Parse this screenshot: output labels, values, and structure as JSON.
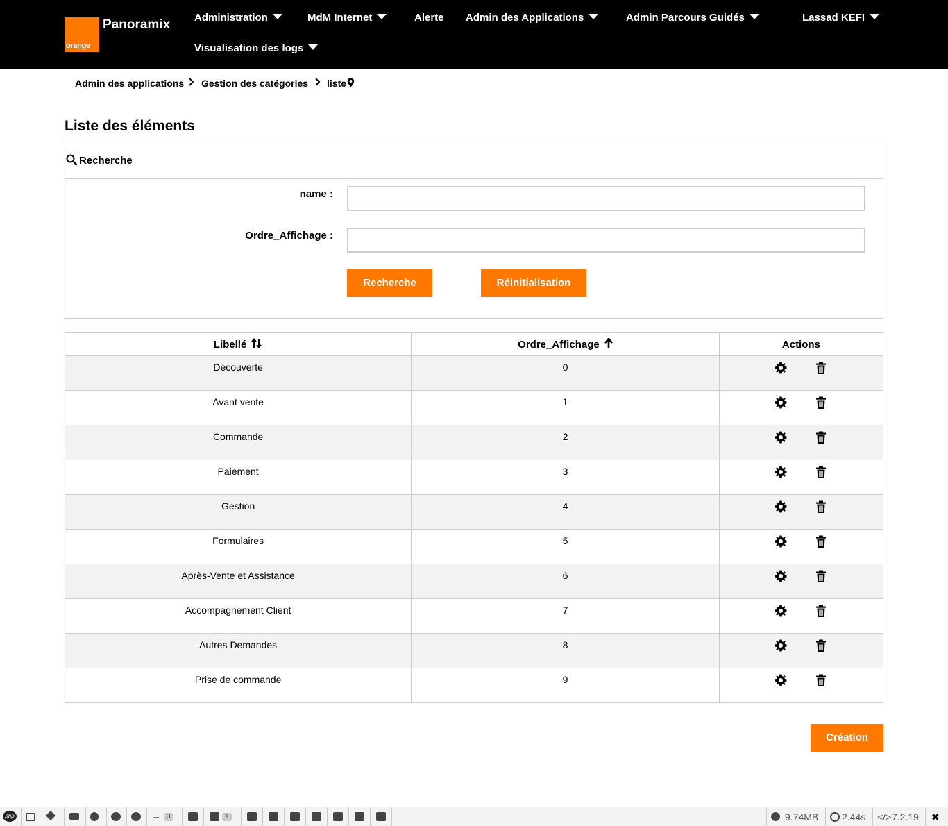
{
  "brand": {
    "logo_text": "orange",
    "app_name": "Panoramix",
    "accent": "#ff7900"
  },
  "nav": {
    "administration": "Administration",
    "mdm_internet": "MdM Internet",
    "alerte": "Alerte",
    "admin_applications": "Admin des Applications",
    "admin_parcours": "Admin Parcours Guidés",
    "user": "Lassad KEFI",
    "visualisation_logs": "Visualisation des logs"
  },
  "breadcrumb": {
    "item1": "Admin des applications",
    "item2": "Gestion des catégories",
    "item3": "liste"
  },
  "page_title": "Liste des éléments",
  "search": {
    "title": "Recherche",
    "name_label": "name :",
    "name_value": "",
    "ordre_label": "Ordre_Affichage :",
    "ordre_value": "",
    "search_button": "Recherche",
    "reset_button": "Réinitialisation"
  },
  "table": {
    "headers": {
      "libelle": "Libellé",
      "ordre": "Ordre_Affichage",
      "actions": "Actions"
    },
    "rows": [
      {
        "libelle": "Découverte",
        "ordre": "0"
      },
      {
        "libelle": "Avant vente",
        "ordre": "1"
      },
      {
        "libelle": "Commande",
        "ordre": "2"
      },
      {
        "libelle": "Paiement",
        "ordre": "3"
      },
      {
        "libelle": "Gestion",
        "ordre": "4"
      },
      {
        "libelle": "Formulaires",
        "ordre": "5"
      },
      {
        "libelle": "Après-Vente et Assistance",
        "ordre": "6"
      },
      {
        "libelle": "Accompagnement Client",
        "ordre": "7"
      },
      {
        "libelle": "Autres Demandes",
        "ordre": "8"
      },
      {
        "libelle": "Prise de commande",
        "ordre": "9"
      }
    ]
  },
  "create_button": "Création",
  "debugbar": {
    "php_label": "php",
    "badge_redirects": "3",
    "badge_count": "1",
    "memory": "9.74MB",
    "time": "2.44s",
    "php_version": "7.2.19",
    "close": "✖"
  }
}
